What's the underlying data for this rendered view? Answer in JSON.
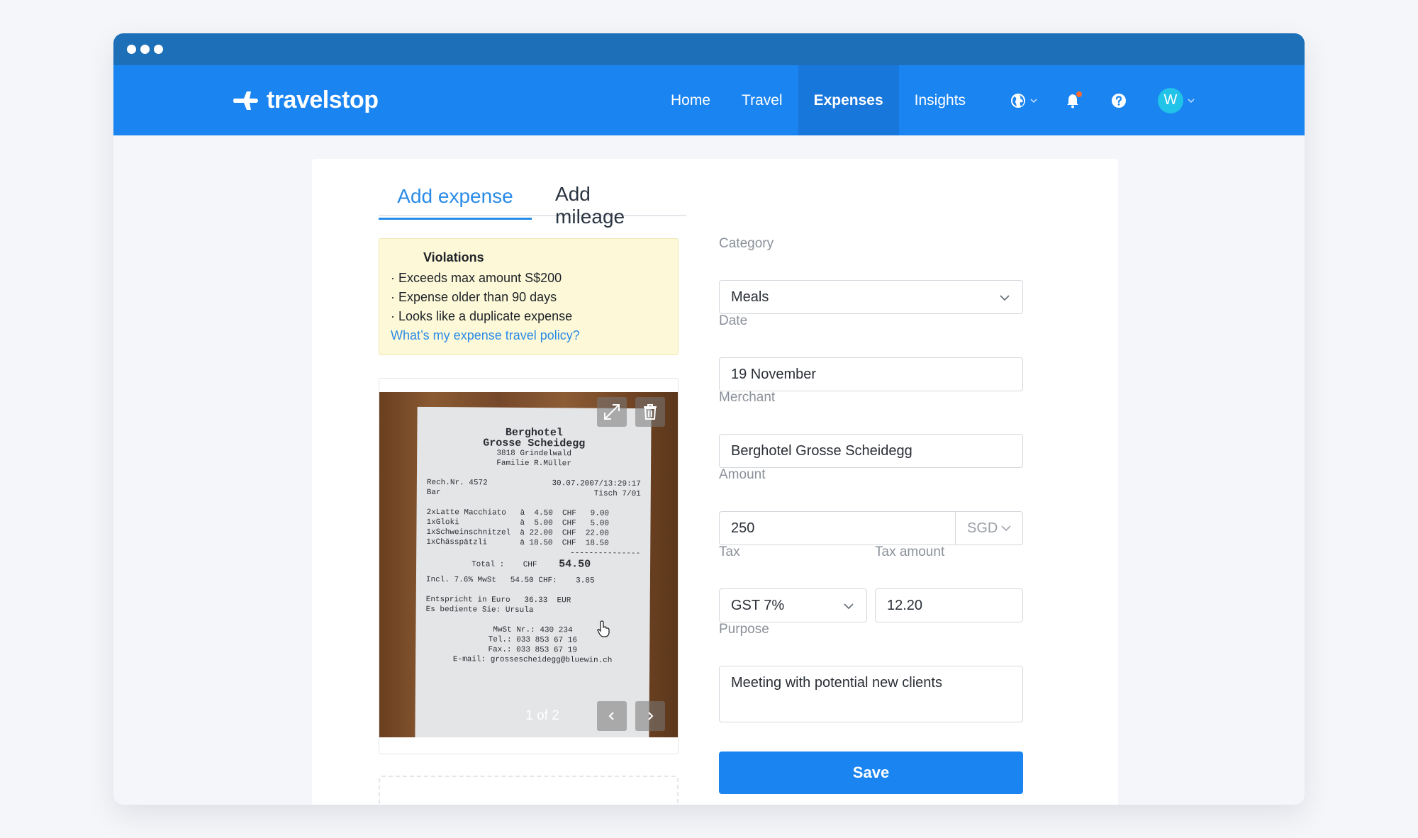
{
  "brand": {
    "name": "travelstop"
  },
  "nav": {
    "links": [
      "Home",
      "Travel",
      "Expenses",
      "Insights"
    ],
    "active": "Expenses",
    "avatar_initial": "W"
  },
  "tabs": {
    "add_expense": "Add expense",
    "add_mileage": "Add mileage"
  },
  "violations": {
    "title": "Violations",
    "items": [
      "· Exceeds max amount S$200",
      "· Expense older than 90 days",
      "· Looks like a duplicate expense"
    ],
    "policy_link": "What’s my expense travel policy?"
  },
  "receipt": {
    "pager": "1 of 2",
    "lines": {
      "name1": "Berghotel",
      "name2": "Grosse Scheidegg",
      "addr": "3818 Grindelwald",
      "family": "Familie R.Müller",
      "rech_left": "Rech.Nr.  4572",
      "rech_right": "30.07.2007/13:29:17",
      "bar_left": "Bar",
      "bar_right": "Tisch   7/01",
      "item1": "2xLatte Macchiato   à  4.50  CHF   9.00",
      "item2": "1xGloki             à  5.00  CHF   5.00",
      "item3": "1xSchweinschnitzel  à 22.00  CHF  22.00",
      "item4": "1xChässpätzli       à 18.50  CHF  18.50",
      "divider": "---------------",
      "total_label": "Total :    CHF",
      "total_value": "54.50",
      "incl": "Incl. 7.6% MwSt   54.50 CHF:    3.85",
      "euro": "Entspricht in Euro   36.33  EUR",
      "served": "Es bediente Sie: Ursula",
      "mwst": "MwSt Nr.: 430 234",
      "tel": "Tel.: 033 853 67 16",
      "fax": "Fax.: 033 853 67 19",
      "email": "E-mail: grossescheidegg@bluewin.ch"
    }
  },
  "form": {
    "category_label": "Category",
    "category_value": "Meals",
    "date_label": "Date",
    "date_value": "19 November",
    "merchant_label": "Merchant",
    "merchant_value": "Berghotel Grosse Scheidegg",
    "amount_label": "Amount",
    "amount_value": "250",
    "currency": "SGD",
    "tax_label": "Tax",
    "tax_value": "GST 7%",
    "tax_amount_label": "Tax amount",
    "tax_amount_value": "12.20",
    "purpose_label": "Purpose",
    "purpose_value": "Meeting with potential new clients",
    "save_label": "Save"
  },
  "colors": {
    "nav_blue": "#1a84f0",
    "titlebar_blue": "#1d70b8",
    "accent": "#2a8be6",
    "warning_bg": "#fdf9d8",
    "avatar": "#21c3e8",
    "notification": "#ff6b2c"
  },
  "icons": [
    "plane-logo-icon",
    "globe-icon",
    "bell-icon",
    "help-icon",
    "chevron-down-icon",
    "expand-icon",
    "trash-icon",
    "chevron-left-icon",
    "chevron-right-icon",
    "cursor-hand-icon"
  ]
}
